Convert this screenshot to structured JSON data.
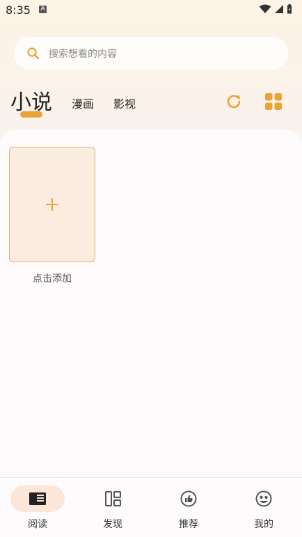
{
  "status_bar": {
    "time": "8:35",
    "indicator": "A"
  },
  "search": {
    "placeholder": "搜索想看的内容"
  },
  "tabs": {
    "active": "小说",
    "items": [
      "漫画",
      "影视"
    ]
  },
  "bookshelf": {
    "add_label": "点击添加",
    "add_symbol": "+"
  },
  "bottom_nav": [
    {
      "label": "阅读",
      "icon": "book-icon",
      "active": true
    },
    {
      "label": "发现",
      "icon": "discover-layout-icon",
      "active": false
    },
    {
      "label": "推荐",
      "icon": "thumbs-up-icon",
      "active": false
    },
    {
      "label": "我的",
      "icon": "profile-face-icon",
      "active": false
    }
  ],
  "colors": {
    "accent": "#e8a33a",
    "card_bg": "#fbece0",
    "pill_bg": "#fbe6d8",
    "icon_gray": "#555555"
  }
}
